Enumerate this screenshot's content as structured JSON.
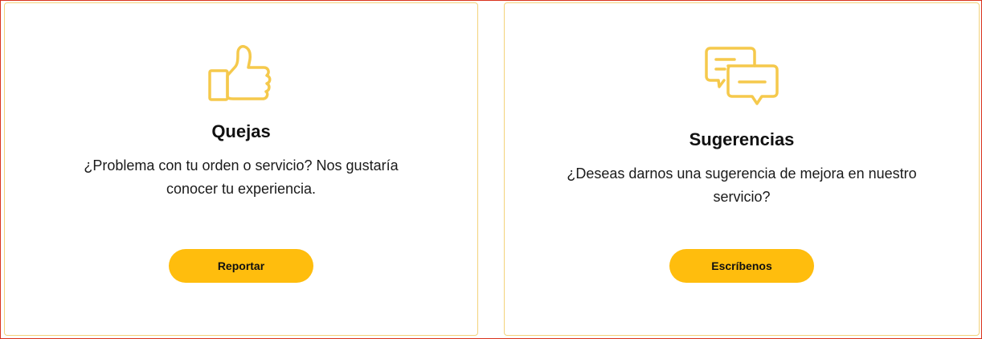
{
  "theme": {
    "accent": "#ffbd0d",
    "icon_stroke": "#f5c94c",
    "card_border": "#f3d37b"
  },
  "cards": [
    {
      "icon": "thumbs-up-icon",
      "title": "Quejas",
      "description_line1": "¿Problema con tu orden o servicio? Nos gustaría",
      "description_line2": "conocer tu experiencia.",
      "button_label": "Reportar"
    },
    {
      "icon": "chat-bubbles-icon",
      "title": "Sugerencias",
      "description_line1": "¿Deseas darnos una sugerencia de mejora en nuestro",
      "description_line2": "servicio?",
      "button_label": "Escríbenos"
    }
  ]
}
